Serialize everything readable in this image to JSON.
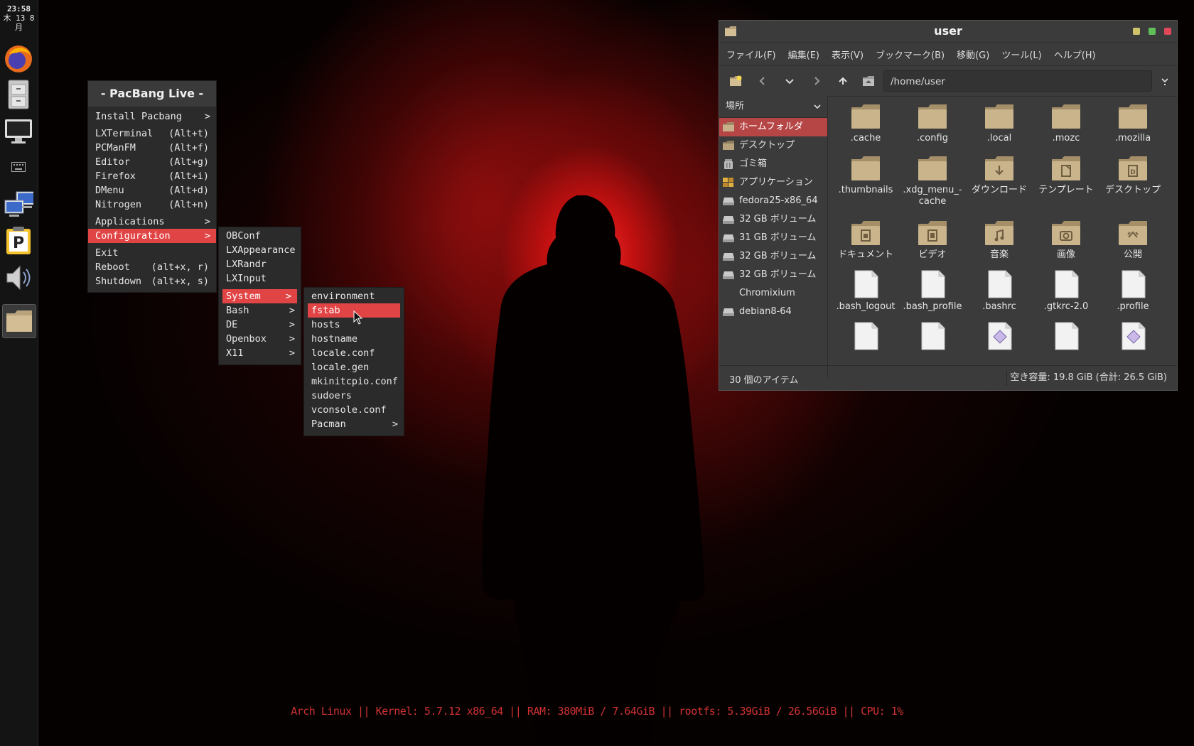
{
  "clock": {
    "time": "23:58",
    "date_line": "木 13  8",
    "month": "月"
  },
  "dock": {
    "items": [
      {
        "name": "firefox-icon"
      },
      {
        "name": "file-cabinet-icon"
      },
      {
        "name": "monitor-icon"
      },
      {
        "name": "keyboard-icon"
      },
      {
        "name": "network-icon"
      },
      {
        "name": "pacbang-icon",
        "glyph": "P"
      },
      {
        "name": "volume-icon"
      },
      {
        "name": "file-manager-icon"
      }
    ]
  },
  "root_menu": {
    "title": "- PacBang Live -",
    "items": [
      {
        "label": "Install Pacbang",
        "sub": true
      },
      {
        "label": "LXTerminal",
        "key": "(Alt+t)"
      },
      {
        "label": "PCManFM",
        "key": "(Alt+f)"
      },
      {
        "label": "Editor",
        "key": "(Alt+g)"
      },
      {
        "label": "Firefox",
        "key": "(Alt+i)"
      },
      {
        "label": "DMenu",
        "key": "(Alt+d)"
      },
      {
        "label": "Nitrogen",
        "key": "(Alt+n)"
      },
      {
        "label": "Applications",
        "sub": true
      },
      {
        "label": "Configuration",
        "sub": true,
        "selected": true
      },
      {
        "label": "Exit"
      },
      {
        "label": "Reboot",
        "key": "(alt+x, r)"
      },
      {
        "label": "Shutdown",
        "key": "(alt+x, s)"
      }
    ]
  },
  "config_menu": {
    "items": [
      {
        "label": "OBConf"
      },
      {
        "label": "LXAppearance"
      },
      {
        "label": "LXRandr"
      },
      {
        "label": "LXInput"
      },
      {
        "label": "System",
        "sub": true,
        "selected": true
      },
      {
        "label": "Bash",
        "sub": true
      },
      {
        "label": "DE",
        "sub": true
      },
      {
        "label": "Openbox",
        "sub": true
      },
      {
        "label": "X11",
        "sub": true
      }
    ]
  },
  "system_menu": {
    "items": [
      {
        "label": "environment"
      },
      {
        "label": "fstab",
        "selected": true
      },
      {
        "label": "hosts"
      },
      {
        "label": "hostname"
      },
      {
        "label": "locale.conf"
      },
      {
        "label": "locale.gen"
      },
      {
        "label": "mkinitcpio.conf"
      },
      {
        "label": "sudoers"
      },
      {
        "label": "vconsole.conf"
      },
      {
        "label": "Pacman",
        "sub": true
      }
    ]
  },
  "arrow_glyph": ">",
  "filemanager": {
    "title": "user",
    "menubar": [
      "ファイル(F)",
      "編集(E)",
      "表示(V)",
      "ブックマーク(B)",
      "移動(G)",
      "ツール(L)",
      "ヘルプ(H)"
    ],
    "path": "/home/user",
    "sidebar_header": "場所",
    "sidebar": [
      {
        "label": "ホームフォルダ",
        "icon": "home-folder-icon",
        "selected": true
      },
      {
        "label": "デスクトップ",
        "icon": "desktop-icon"
      },
      {
        "label": "ゴミ箱",
        "icon": "trash-icon"
      },
      {
        "label": "アプリケーション",
        "icon": "applications-icon"
      },
      {
        "label": "fedora25-x86_64",
        "icon": "drive-icon"
      },
      {
        "label": "32 GB ボリューム",
        "icon": "drive-icon"
      },
      {
        "label": "31 GB ボリューム",
        "icon": "drive-icon"
      },
      {
        "label": "32 GB ボリューム",
        "icon": "drive-icon"
      },
      {
        "label": "32 GB ボリューム",
        "icon": "drive-icon"
      },
      {
        "label": "Chromixium",
        "icon": "drive-icon"
      },
      {
        "label": "debian8-64",
        "icon": "drive-icon"
      }
    ],
    "files": [
      {
        "name": ".cache",
        "type": "folder"
      },
      {
        "name": ".config",
        "type": "folder"
      },
      {
        "name": ".local",
        "type": "folder"
      },
      {
        "name": ".mozc",
        "type": "folder"
      },
      {
        "name": ".mozilla",
        "type": "folder"
      },
      {
        "name": ".thumbnails",
        "type": "folder"
      },
      {
        "name": ".xdg_menu_-cache",
        "type": "folder"
      },
      {
        "name": "ダウンロード",
        "type": "folder-download"
      },
      {
        "name": "テンプレート",
        "type": "folder-template"
      },
      {
        "name": "デスクトップ",
        "type": "folder-desktop"
      },
      {
        "name": "ドキュメント",
        "type": "folder-documents"
      },
      {
        "name": "ビデオ",
        "type": "folder-video"
      },
      {
        "name": "音楽",
        "type": "folder-music"
      },
      {
        "name": "画像",
        "type": "folder-pictures"
      },
      {
        "name": "公開",
        "type": "folder-public"
      },
      {
        "name": ".bash_logout",
        "type": "file"
      },
      {
        "name": ".bash_profile",
        "type": "file"
      },
      {
        "name": ".bashrc",
        "type": "file"
      },
      {
        "name": ".gtkrc-2.0",
        "type": "file"
      },
      {
        "name": ".profile",
        "type": "file"
      },
      {
        "name": "",
        "type": "file"
      },
      {
        "name": "",
        "type": "file"
      },
      {
        "name": "",
        "type": "file-diamond"
      },
      {
        "name": "",
        "type": "file"
      },
      {
        "name": "",
        "type": "file-diamond"
      }
    ],
    "status_count": "30 個のアイテム",
    "status_free": "空き容量: 19.8 GiB (合計: 26.5 GiB)"
  },
  "conky": "Arch Linux || Kernel: 5.7.12 x86_64 || RAM: 380MiB / 7.64GiB || rootfs: 5.39GiB / 26.56GiB || CPU: 1%",
  "colors": {
    "accent": "#e14444",
    "sidebar_selected": "#b64646",
    "conky": "#d03232",
    "folder": "#c9b48c"
  }
}
